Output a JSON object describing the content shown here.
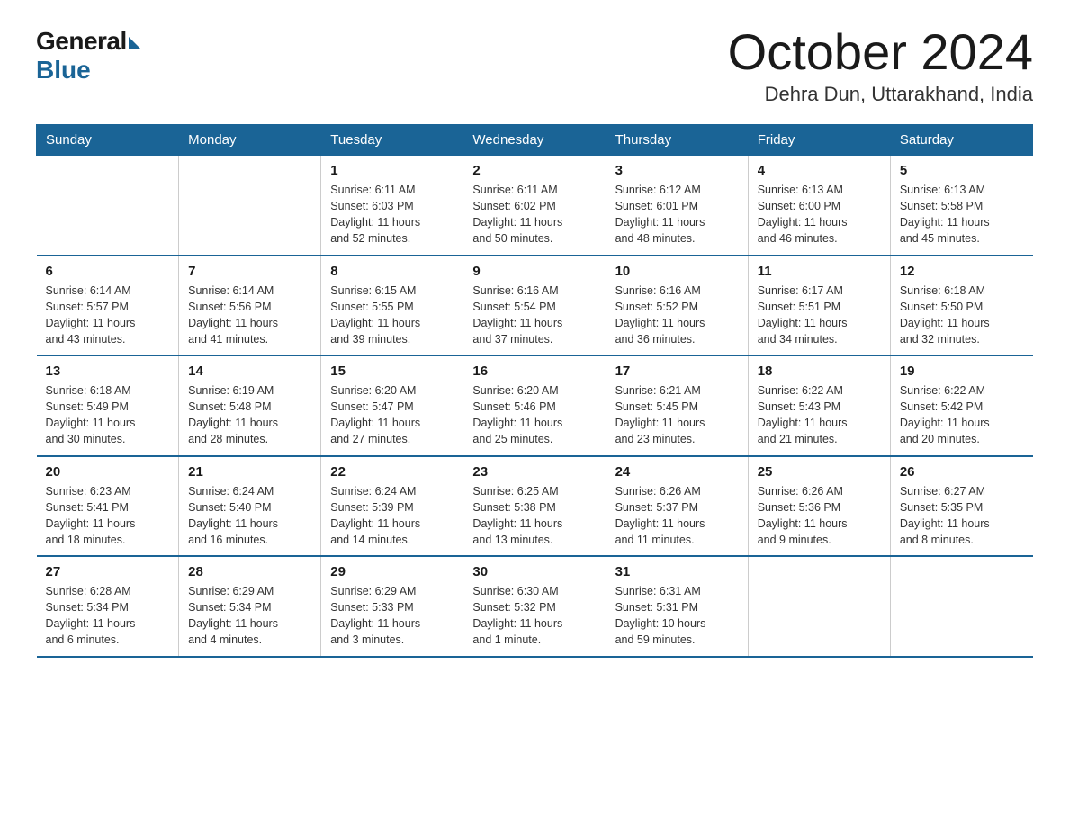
{
  "logo": {
    "general": "General",
    "blue": "Blue"
  },
  "title": "October 2024",
  "location": "Dehra Dun, Uttarakhand, India",
  "header_days": [
    "Sunday",
    "Monday",
    "Tuesday",
    "Wednesday",
    "Thursday",
    "Friday",
    "Saturday"
  ],
  "weeks": [
    [
      {
        "day": "",
        "info": ""
      },
      {
        "day": "",
        "info": ""
      },
      {
        "day": "1",
        "info": "Sunrise: 6:11 AM\nSunset: 6:03 PM\nDaylight: 11 hours\nand 52 minutes."
      },
      {
        "day": "2",
        "info": "Sunrise: 6:11 AM\nSunset: 6:02 PM\nDaylight: 11 hours\nand 50 minutes."
      },
      {
        "day": "3",
        "info": "Sunrise: 6:12 AM\nSunset: 6:01 PM\nDaylight: 11 hours\nand 48 minutes."
      },
      {
        "day": "4",
        "info": "Sunrise: 6:13 AM\nSunset: 6:00 PM\nDaylight: 11 hours\nand 46 minutes."
      },
      {
        "day": "5",
        "info": "Sunrise: 6:13 AM\nSunset: 5:58 PM\nDaylight: 11 hours\nand 45 minutes."
      }
    ],
    [
      {
        "day": "6",
        "info": "Sunrise: 6:14 AM\nSunset: 5:57 PM\nDaylight: 11 hours\nand 43 minutes."
      },
      {
        "day": "7",
        "info": "Sunrise: 6:14 AM\nSunset: 5:56 PM\nDaylight: 11 hours\nand 41 minutes."
      },
      {
        "day": "8",
        "info": "Sunrise: 6:15 AM\nSunset: 5:55 PM\nDaylight: 11 hours\nand 39 minutes."
      },
      {
        "day": "9",
        "info": "Sunrise: 6:16 AM\nSunset: 5:54 PM\nDaylight: 11 hours\nand 37 minutes."
      },
      {
        "day": "10",
        "info": "Sunrise: 6:16 AM\nSunset: 5:52 PM\nDaylight: 11 hours\nand 36 minutes."
      },
      {
        "day": "11",
        "info": "Sunrise: 6:17 AM\nSunset: 5:51 PM\nDaylight: 11 hours\nand 34 minutes."
      },
      {
        "day": "12",
        "info": "Sunrise: 6:18 AM\nSunset: 5:50 PM\nDaylight: 11 hours\nand 32 minutes."
      }
    ],
    [
      {
        "day": "13",
        "info": "Sunrise: 6:18 AM\nSunset: 5:49 PM\nDaylight: 11 hours\nand 30 minutes."
      },
      {
        "day": "14",
        "info": "Sunrise: 6:19 AM\nSunset: 5:48 PM\nDaylight: 11 hours\nand 28 minutes."
      },
      {
        "day": "15",
        "info": "Sunrise: 6:20 AM\nSunset: 5:47 PM\nDaylight: 11 hours\nand 27 minutes."
      },
      {
        "day": "16",
        "info": "Sunrise: 6:20 AM\nSunset: 5:46 PM\nDaylight: 11 hours\nand 25 minutes."
      },
      {
        "day": "17",
        "info": "Sunrise: 6:21 AM\nSunset: 5:45 PM\nDaylight: 11 hours\nand 23 minutes."
      },
      {
        "day": "18",
        "info": "Sunrise: 6:22 AM\nSunset: 5:43 PM\nDaylight: 11 hours\nand 21 minutes."
      },
      {
        "day": "19",
        "info": "Sunrise: 6:22 AM\nSunset: 5:42 PM\nDaylight: 11 hours\nand 20 minutes."
      }
    ],
    [
      {
        "day": "20",
        "info": "Sunrise: 6:23 AM\nSunset: 5:41 PM\nDaylight: 11 hours\nand 18 minutes."
      },
      {
        "day": "21",
        "info": "Sunrise: 6:24 AM\nSunset: 5:40 PM\nDaylight: 11 hours\nand 16 minutes."
      },
      {
        "day": "22",
        "info": "Sunrise: 6:24 AM\nSunset: 5:39 PM\nDaylight: 11 hours\nand 14 minutes."
      },
      {
        "day": "23",
        "info": "Sunrise: 6:25 AM\nSunset: 5:38 PM\nDaylight: 11 hours\nand 13 minutes."
      },
      {
        "day": "24",
        "info": "Sunrise: 6:26 AM\nSunset: 5:37 PM\nDaylight: 11 hours\nand 11 minutes."
      },
      {
        "day": "25",
        "info": "Sunrise: 6:26 AM\nSunset: 5:36 PM\nDaylight: 11 hours\nand 9 minutes."
      },
      {
        "day": "26",
        "info": "Sunrise: 6:27 AM\nSunset: 5:35 PM\nDaylight: 11 hours\nand 8 minutes."
      }
    ],
    [
      {
        "day": "27",
        "info": "Sunrise: 6:28 AM\nSunset: 5:34 PM\nDaylight: 11 hours\nand 6 minutes."
      },
      {
        "day": "28",
        "info": "Sunrise: 6:29 AM\nSunset: 5:34 PM\nDaylight: 11 hours\nand 4 minutes."
      },
      {
        "day": "29",
        "info": "Sunrise: 6:29 AM\nSunset: 5:33 PM\nDaylight: 11 hours\nand 3 minutes."
      },
      {
        "day": "30",
        "info": "Sunrise: 6:30 AM\nSunset: 5:32 PM\nDaylight: 11 hours\nand 1 minute."
      },
      {
        "day": "31",
        "info": "Sunrise: 6:31 AM\nSunset: 5:31 PM\nDaylight: 10 hours\nand 59 minutes."
      },
      {
        "day": "",
        "info": ""
      },
      {
        "day": "",
        "info": ""
      }
    ]
  ]
}
